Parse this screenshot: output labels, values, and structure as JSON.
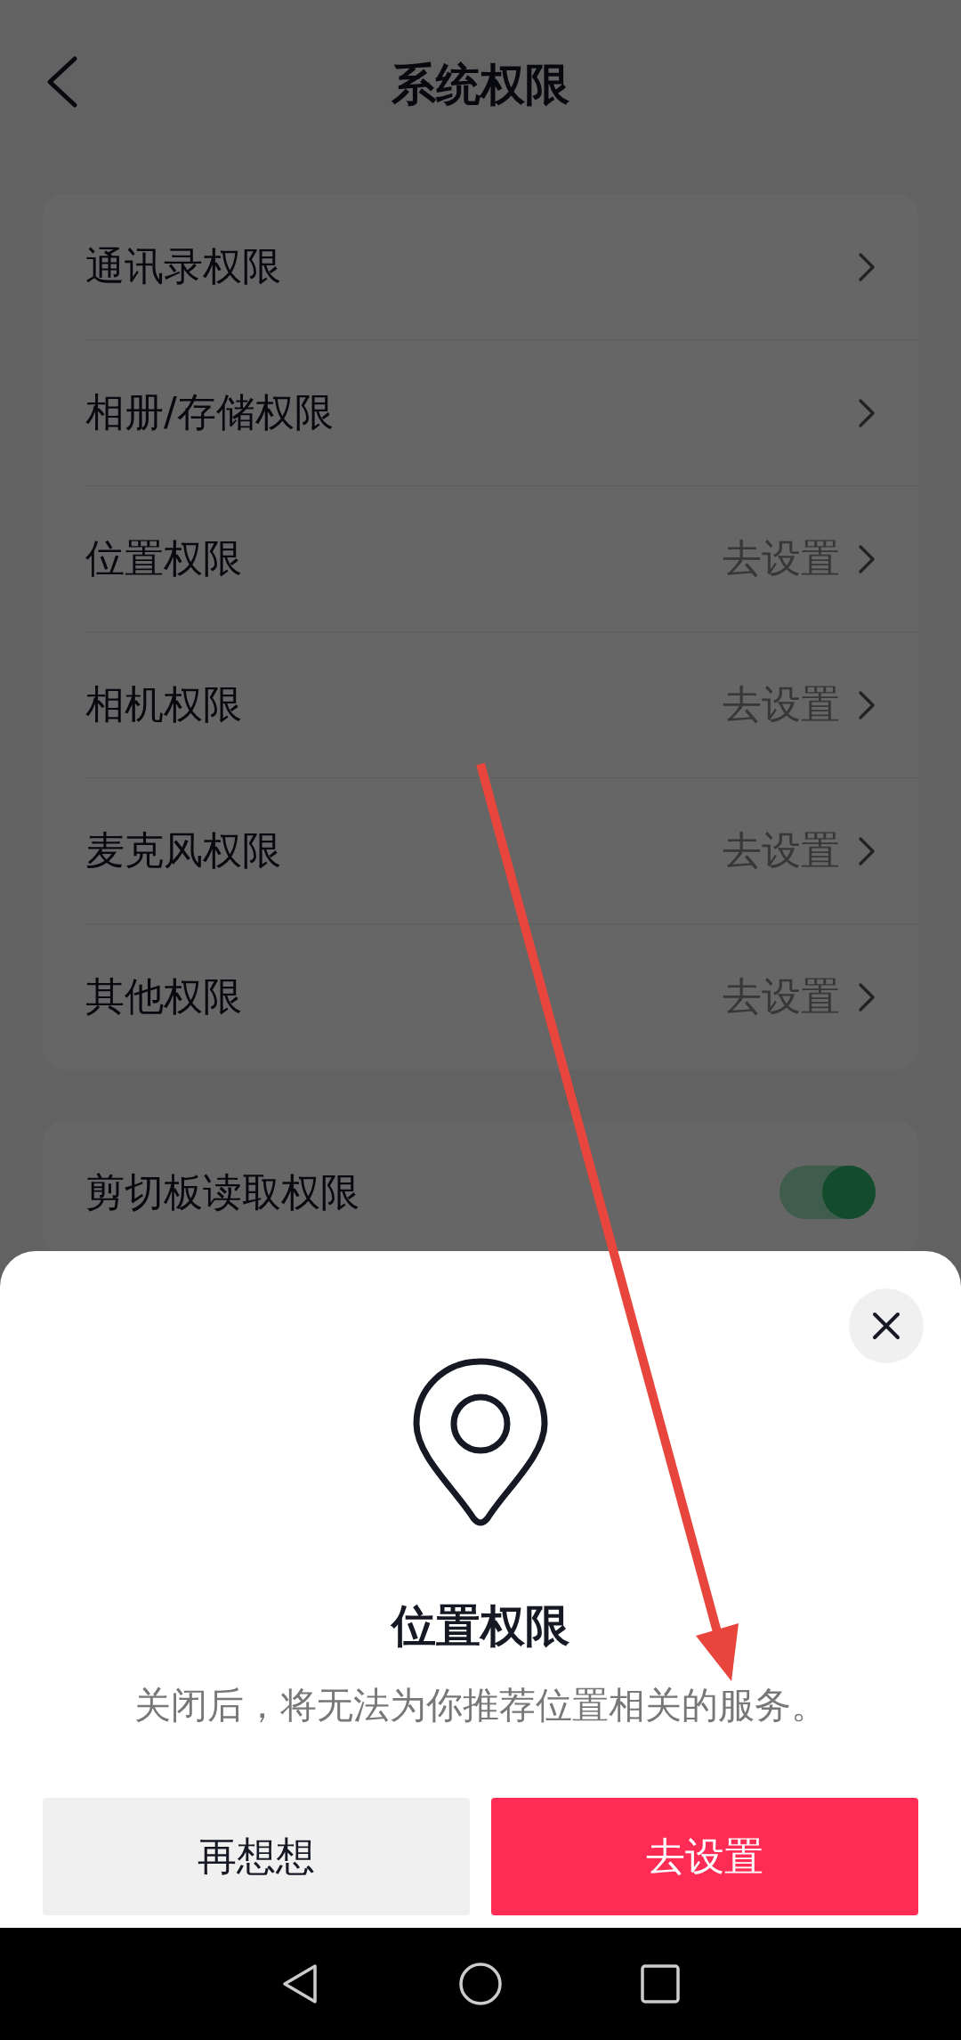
{
  "header": {
    "title": "系统权限"
  },
  "permissions": [
    {
      "label": "通讯录权限"
    },
    {
      "label": "相册/存储权限"
    },
    {
      "label": "位置权限",
      "action": "去设置"
    },
    {
      "label": "相机权限",
      "action": "去设置"
    },
    {
      "label": "麦克风权限",
      "action": "去设置"
    },
    {
      "label": "其他权限",
      "action": "去设置"
    }
  ],
  "clipboard": {
    "label": "剪切板读取权限",
    "on": true
  },
  "sheet": {
    "title": "位置权限",
    "description": "关闭后，将无法为你推荐位置相关的服务。",
    "buttons": [
      {
        "label": "再想想",
        "kind": "secondary"
      },
      {
        "label": "去设置",
        "kind": "primary"
      }
    ]
  }
}
